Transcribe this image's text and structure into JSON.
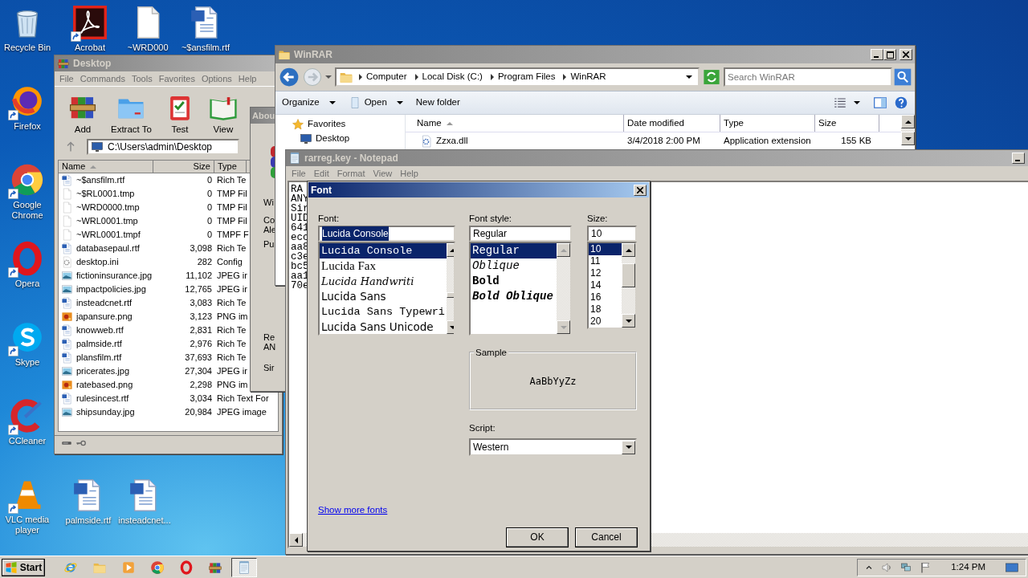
{
  "desktop_icons_left": [
    {
      "label": "Recycle Bin",
      "kind": "recycle",
      "shortcut": false
    },
    {
      "label": "Firefox",
      "kind": "firefox",
      "shortcut": true
    },
    {
      "label": "Google Chrome",
      "kind": "chrome",
      "shortcut": true
    },
    {
      "label": "Opera",
      "kind": "opera",
      "shortcut": true
    },
    {
      "label": "Skype",
      "kind": "skype",
      "shortcut": true
    },
    {
      "label": "CCleaner",
      "kind": "ccleaner",
      "shortcut": true
    },
    {
      "label": "VLC media player",
      "kind": "vlc",
      "shortcut": true
    }
  ],
  "desktop_icons_top": [
    {
      "label": "Acrobat",
      "kind": "acrobat",
      "shortcut": true
    },
    {
      "label": "~WRD000",
      "kind": "blank",
      "shortcut": false
    },
    {
      "label": "~$ansfilm.rtf",
      "kind": "word",
      "shortcut": false
    }
  ],
  "desktop_icons_bottom": [
    {
      "label": "palmside.rtf",
      "kind": "word",
      "shortcut": false
    },
    {
      "label": "insteadcnet...",
      "kind": "word",
      "shortcut": false
    }
  ],
  "archive_window": {
    "title": "Desktop",
    "menu": [
      "File",
      "Commands",
      "Tools",
      "Favorites",
      "Options",
      "Help"
    ],
    "toolbar": [
      {
        "label": "Add",
        "kind": "books"
      },
      {
        "label": "Extract To",
        "kind": "folderblue"
      },
      {
        "label": "Test",
        "kind": "test"
      },
      {
        "label": "View",
        "kind": "view"
      }
    ],
    "path": "C:\\Users\\admin\\Desktop",
    "columns": [
      "Name",
      "Size",
      "Type"
    ],
    "rows": [
      {
        "name": "~$ansfilm.rtf",
        "size": "0",
        "type": "Rich Te",
        "kind": "word"
      },
      {
        "name": "~$RL0001.tmp",
        "size": "0",
        "type": "TMP Fil",
        "kind": "blank"
      },
      {
        "name": "~WRD0000.tmp",
        "size": "0",
        "type": "TMP Fil",
        "kind": "blank"
      },
      {
        "name": "~WRL0001.tmp",
        "size": "0",
        "type": "TMP Fil",
        "kind": "blank"
      },
      {
        "name": "~WRL0001.tmpf",
        "size": "0",
        "type": "TMPF F",
        "kind": "blank"
      },
      {
        "name": "databasepaul.rtf",
        "size": "3,098",
        "type": "Rich Te",
        "kind": "word"
      },
      {
        "name": "desktop.ini",
        "size": "282",
        "type": "Config",
        "kind": "ini"
      },
      {
        "name": "fictioninsurance.jpg",
        "size": "11,102",
        "type": "JPEG ir",
        "kind": "image"
      },
      {
        "name": "impactpolicies.jpg",
        "size": "12,765",
        "type": "JPEG ir",
        "kind": "image"
      },
      {
        "name": "insteadcnet.rtf",
        "size": "3,083",
        "type": "Rich Te",
        "kind": "word"
      },
      {
        "name": "japansure.png",
        "size": "3,123",
        "type": "PNG im",
        "kind": "png"
      },
      {
        "name": "knowweb.rtf",
        "size": "2,831",
        "type": "Rich Te",
        "kind": "word"
      },
      {
        "name": "palmside.rtf",
        "size": "2,976",
        "type": "Rich Te",
        "kind": "word"
      },
      {
        "name": "plansfilm.rtf",
        "size": "37,693",
        "type": "Rich Te",
        "kind": "word"
      },
      {
        "name": "pricerates.jpg",
        "size": "27,304",
        "type": "JPEG ir",
        "kind": "image"
      },
      {
        "name": "ratebased.png",
        "size": "2,298",
        "type": "PNG im",
        "kind": "png"
      },
      {
        "name": "rulesincest.rtf",
        "size": "3,034",
        "type": "Rich Text For",
        "kind": "word"
      },
      {
        "name": "shipsunday.jpg",
        "size": "20,984",
        "type": "JPEG image",
        "kind": "image"
      }
    ]
  },
  "about_window": {
    "title": "Abou",
    "texts": [
      "Wi",
      "Co",
      "Ale",
      "Pu",
      "Re",
      "AN",
      "Sir"
    ]
  },
  "explorer_window": {
    "title": "WinRAR",
    "breadcrumb": [
      "Computer",
      "Local Disk (C:)",
      "Program Files",
      "WinRAR"
    ],
    "search": {
      "placeholder": "Search WinRAR"
    },
    "toolbar": [
      {
        "label": "Organize",
        "kind": "plain",
        "dropdown": true
      },
      {
        "label": "Open",
        "kind": "open",
        "dropdown": true
      },
      {
        "label": "New folder",
        "kind": "plain",
        "dropdown": false
      }
    ],
    "nav": [
      {
        "label": "Favorites",
        "kind": "star"
      },
      {
        "label": "Desktop",
        "kind": "monitor"
      }
    ],
    "columns": [
      "Name",
      "Date modified",
      "Type",
      "Size"
    ],
    "rows": [
      {
        "name": "Zzxa.dll",
        "date": "3/4/2018 2:00 PM",
        "type": "Application extension",
        "size": "155 KB"
      }
    ]
  },
  "notepad": {
    "title": "rarreg.key - Notepad",
    "menu": [
      "File",
      "Edit",
      "Format",
      "View",
      "Help"
    ],
    "lines": [
      "RA",
      "ANY",
      "Sir",
      "UID",
      "641",
      "ecc",
      "aa8",
      "c3e",
      "bc5",
      "aa1",
      "70e"
    ]
  },
  "font_dialog": {
    "title": "Font",
    "font_label": "Font:",
    "font_value": "Lucida Console",
    "fonts": [
      {
        "label": "Lucida Console",
        "kind": "mono",
        "selected": true
      },
      {
        "label": "Lucida Fax",
        "kind": "serif",
        "selected": false
      },
      {
        "label": "Lucida Handwriti",
        "kind": "script",
        "selected": false
      },
      {
        "label": "Lucida Sans",
        "kind": "sans",
        "selected": false
      },
      {
        "label": "Lucida Sans Typewri",
        "kind": "mono",
        "selected": false
      },
      {
        "label": "Lucida Sans Unicode",
        "kind": "sans",
        "selected": false
      }
    ],
    "style_label": "Font style:",
    "style_value": "Regular",
    "styles": [
      {
        "label": "Regular",
        "kind": "regular",
        "selected": true
      },
      {
        "label": "Oblique",
        "kind": "italic",
        "selected": false
      },
      {
        "label": "Bold",
        "kind": "bold",
        "selected": false
      },
      {
        "label": "Bold Oblique",
        "kind": "bolditalic",
        "selected": false
      }
    ],
    "size_label": "Size:",
    "size_value": "10",
    "sizes": [
      {
        "label": "10",
        "selected": true
      },
      {
        "label": "11",
        "selected": false
      },
      {
        "label": "12",
        "selected": false
      },
      {
        "label": "14",
        "selected": false
      },
      {
        "label": "16",
        "selected": false
      },
      {
        "label": "18",
        "selected": false
      },
      {
        "label": "20",
        "selected": false
      }
    ],
    "sample_label": "Sample",
    "sample_text": "AaBbYyZz",
    "script_label": "Script:",
    "script_value": "Western",
    "link": "Show more fonts",
    "buttons": [
      "OK",
      "Cancel"
    ]
  },
  "taskbar": {
    "start": "Start",
    "apps": [
      {
        "kind": "ie",
        "selected": false
      },
      {
        "kind": "folder",
        "selected": false
      },
      {
        "kind": "media",
        "selected": false
      },
      {
        "kind": "chrome",
        "selected": false
      },
      {
        "kind": "opera",
        "selected": false
      },
      {
        "kind": "books",
        "selected": false
      },
      {
        "kind": "notepad",
        "selected": true
      }
    ],
    "clock": "1:24 PM"
  }
}
